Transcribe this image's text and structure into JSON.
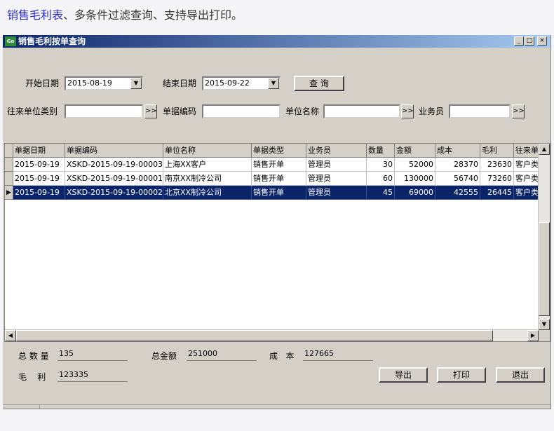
{
  "caption": {
    "highlight": "销售毛利表",
    "rest": "、多条件过滤查询、支持导出打印。"
  },
  "window": {
    "title": "销售毛利按单查询",
    "app_icon_text": "Go",
    "minimize": "_",
    "restore": "□",
    "close": "×"
  },
  "filters": {
    "start_date_label": "开始日期",
    "start_date_value": "2015-08-19",
    "end_date_label": "结束日期",
    "end_date_value": "2015-09-22",
    "query_button": "查 询",
    "category_label": "往来单位类别",
    "category_value": "",
    "doc_no_label": "单据编码",
    "doc_no_value": "",
    "unit_name_label": "单位名称",
    "unit_name_value": "",
    "salesman_label": "业务员",
    "salesman_value": "",
    "browse_glyph": ">>",
    "dropdown_glyph": "▼"
  },
  "table": {
    "columns": [
      "单据日期",
      "单据编码",
      "单位名称",
      "单据类型",
      "业务员",
      "数量",
      "金额",
      "成本",
      "毛利",
      "往来单"
    ],
    "rows": [
      [
        "2015-09-19",
        "XSKD-2015-09-19-00003",
        "上海XX客户",
        "销售开单",
        "管理员",
        "30",
        "52000",
        "28370",
        "23630",
        "客户类"
      ],
      [
        "2015-09-19",
        "XSKD-2015-09-19-00001",
        "南京XX制冷公司",
        "销售开单",
        "管理员",
        "60",
        "130000",
        "56740",
        "73260",
        "客户类"
      ],
      [
        "2015-09-19",
        "XSKD-2015-09-19-00002",
        "北京XX制冷公司",
        "销售开单",
        "管理员",
        "45",
        "69000",
        "42555",
        "26445",
        "客户类"
      ]
    ],
    "selected_row_index": 2,
    "row_indicator": "▶"
  },
  "summary": {
    "total_qty_label": "总 数 量",
    "total_qty_value": "135",
    "total_amount_label": "总金额",
    "total_amount_value": "251000",
    "cost_label": "成   本",
    "cost_value": "127665",
    "profit_label": "毛    利",
    "profit_value": "123335"
  },
  "actions": {
    "export": "导出",
    "print": "打印",
    "exit": "退出"
  },
  "colors": {
    "title_start": "#0a246a",
    "title_end": "#a6caf0",
    "selection": "#0a246a",
    "caption_highlight": "#2d2dc8"
  }
}
